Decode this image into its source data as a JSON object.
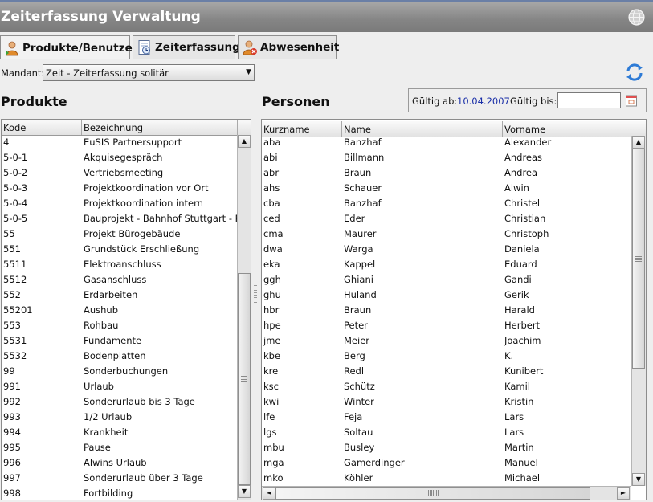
{
  "window": {
    "title": "Zeiterfassung Verwaltung",
    "globe_icon": "globe-icon"
  },
  "tabs": [
    {
      "label": "Produkte/Benutzer",
      "icon": "user-icon",
      "active": true
    },
    {
      "label": "Zeiterfassung",
      "icon": "clock-document-icon",
      "active": false
    },
    {
      "label": "Abwesenheit",
      "icon": "user-cancel-icon",
      "active": false
    }
  ],
  "mandant": {
    "label": "Mandant:",
    "value": "Zeit - Zeiterfassung solitär"
  },
  "produkte": {
    "title": "Produkte",
    "columns": [
      "Kode",
      "Bezeichnung"
    ],
    "rows": [
      [
        "4",
        "EuSIS Partnersupport"
      ],
      [
        "5-0-1",
        "Akquisegespräch"
      ],
      [
        "5-0-2",
        "Vertriebsmeeting"
      ],
      [
        "5-0-3",
        "Projektkoordination vor Ort"
      ],
      [
        "5-0-4",
        "Projektkoordination intern"
      ],
      [
        "5-0-5",
        "Bauprojekt - Bahnhof Stuttgart - P..."
      ],
      [
        "55",
        "Projekt Bürogebäude"
      ],
      [
        "551",
        "Grundstück Erschließung"
      ],
      [
        "5511",
        "Elektroanschluss"
      ],
      [
        "5512",
        "Gasanschluss"
      ],
      [
        "552",
        "Erdarbeiten"
      ],
      [
        "55201",
        "Aushub"
      ],
      [
        "553",
        "Rohbau"
      ],
      [
        "5531",
        "Fundamente"
      ],
      [
        "5532",
        "Bodenplatten"
      ],
      [
        "99",
        "Sonderbuchungen"
      ],
      [
        "991",
        "Urlaub"
      ],
      [
        "992",
        "Sonderurlaub bis 3 Tage"
      ],
      [
        "993",
        "1/2 Urlaub"
      ],
      [
        "994",
        "Krankheit"
      ],
      [
        "995",
        "Pause"
      ],
      [
        "996",
        "Alwins Urlaub"
      ],
      [
        "997",
        "Sonderurlaub über 3 Tage"
      ],
      [
        "998",
        "Fortbilding"
      ]
    ]
  },
  "personen": {
    "title": "Personen",
    "valid_from_label": "Gültig ab:",
    "valid_from_value": "10.04.2007",
    "valid_to_label": "Gültig bis:",
    "valid_to_value": "",
    "columns": [
      "Kurzname",
      "Name",
      "Vorname"
    ],
    "rows": [
      [
        "aba",
        "Banzhaf",
        "Alexander"
      ],
      [
        "abi",
        "Billmann",
        "Andreas"
      ],
      [
        "abr",
        "Braun",
        "Andrea"
      ],
      [
        "ahs",
        "Schauer",
        "Alwin"
      ],
      [
        "cba",
        "Banzhaf",
        "Christel"
      ],
      [
        "ced",
        "Eder",
        "Christian"
      ],
      [
        "cma",
        "Maurer",
        "Christoph"
      ],
      [
        "dwa",
        "Warga",
        "Daniela"
      ],
      [
        "eka",
        "Kappel",
        "Eduard"
      ],
      [
        "ggh",
        "Ghiani",
        "Gandi"
      ],
      [
        "ghu",
        "Huland",
        "Gerik"
      ],
      [
        "hbr",
        "Braun",
        "Harald"
      ],
      [
        "hpe",
        "Peter",
        "Herbert"
      ],
      [
        "jme",
        "Meier",
        "Joachim"
      ],
      [
        "kbe",
        "Berg",
        "K."
      ],
      [
        "kre",
        "Redl",
        "Kunibert"
      ],
      [
        "ksc",
        "Schütz",
        "Kamil"
      ],
      [
        "kwi",
        "Winter",
        "Kristin"
      ],
      [
        "lfe",
        "Feja",
        "Lars"
      ],
      [
        "lgs",
        "Soltau",
        "Lars"
      ],
      [
        "mbu",
        "Busley",
        "Martin"
      ],
      [
        "mga",
        "Gamerdinger",
        "Manuel"
      ],
      [
        "mko",
        "Köhler",
        "Michael"
      ]
    ]
  }
}
